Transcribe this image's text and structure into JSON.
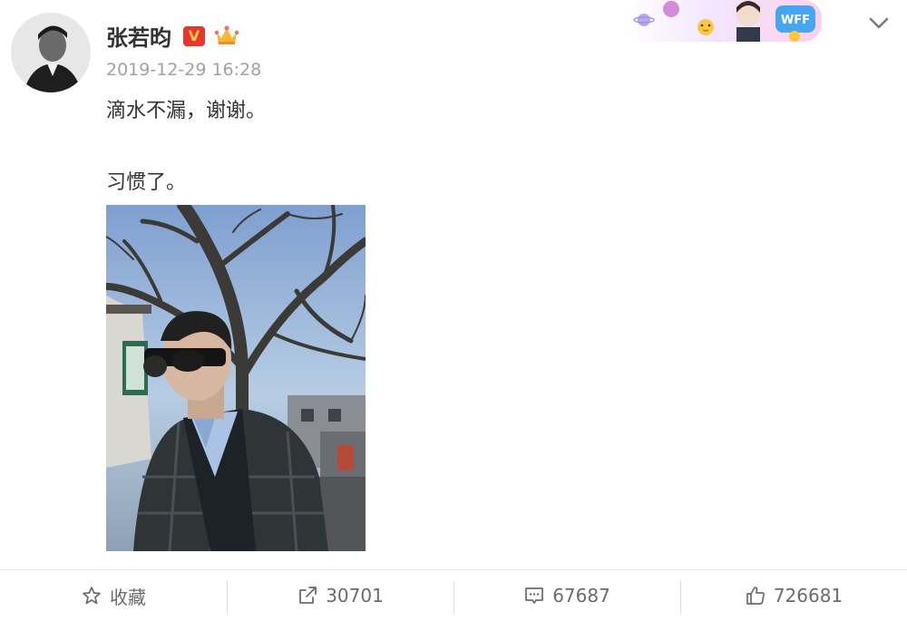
{
  "post": {
    "author": "张若昀",
    "timestamp": "2019-12-29 16:28",
    "lines": [
      "滴水不漏，谢谢。",
      "习惯了。"
    ],
    "vip_badge": "V"
  },
  "icons": {
    "verified_badge": "verified-v-icon",
    "membership": "crown-icon",
    "menu": "chevron-down-icon",
    "favorite": "star-icon",
    "repost": "share-icon",
    "comment": "comment-icon",
    "like": "thumbs-up-icon"
  },
  "actions": {
    "favorite_label": "收藏",
    "repost_count": "30701",
    "comment_count": "67687",
    "like_count": "726681"
  },
  "decoration": {
    "sticker_text": "WFF"
  }
}
